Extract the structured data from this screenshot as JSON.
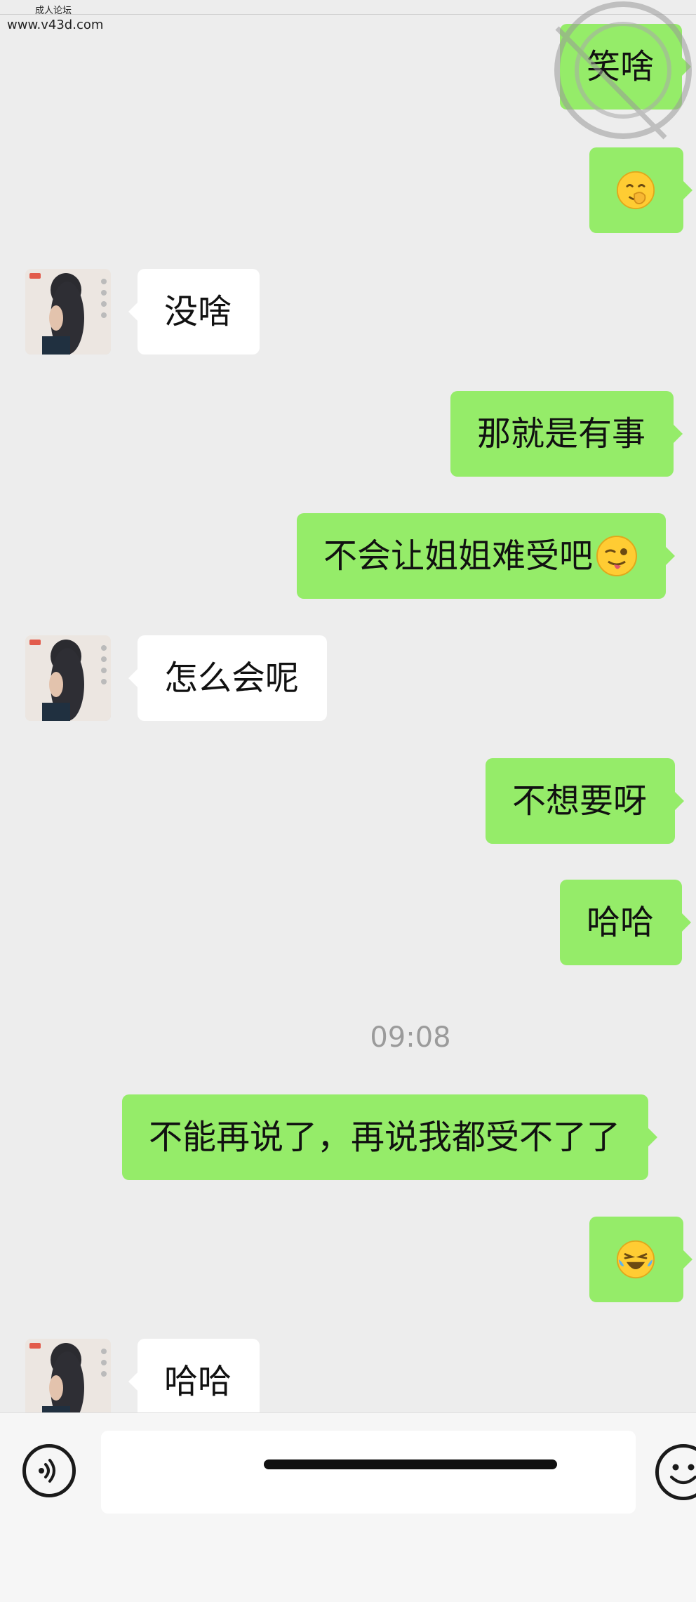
{
  "watermark": {
    "site_name": "成人论坛",
    "url": "www.v43d.com"
  },
  "messages": [
    {
      "side": "right",
      "text": "笑啥"
    },
    {
      "side": "right",
      "emoji": "cover-mouth-emoji"
    },
    {
      "side": "left",
      "text": "没啥"
    },
    {
      "side": "right",
      "text": "那就是有事"
    },
    {
      "side": "right",
      "text": "不会让姐姐难受吧",
      "emoji": "wink-tongue-emoji"
    },
    {
      "side": "left",
      "text": "怎么会呢"
    },
    {
      "side": "right",
      "text": "不想要呀"
    },
    {
      "side": "right",
      "text": "哈哈"
    },
    {
      "side": "right",
      "text": "不能再说了，再说我都受不了了"
    },
    {
      "side": "right",
      "emoji": "laughing-tears-emoji"
    },
    {
      "side": "left",
      "text": "哈哈"
    }
  ],
  "timestamp": "09:08",
  "input": {
    "value": "",
    "voice_icon": "voice-icon",
    "emoji_icon": "smiley-icon"
  },
  "colors": {
    "background": "#ededed",
    "sent_bubble": "#95ec69",
    "received_bubble": "#ffffff",
    "timestamp": "#9b9b9b"
  }
}
